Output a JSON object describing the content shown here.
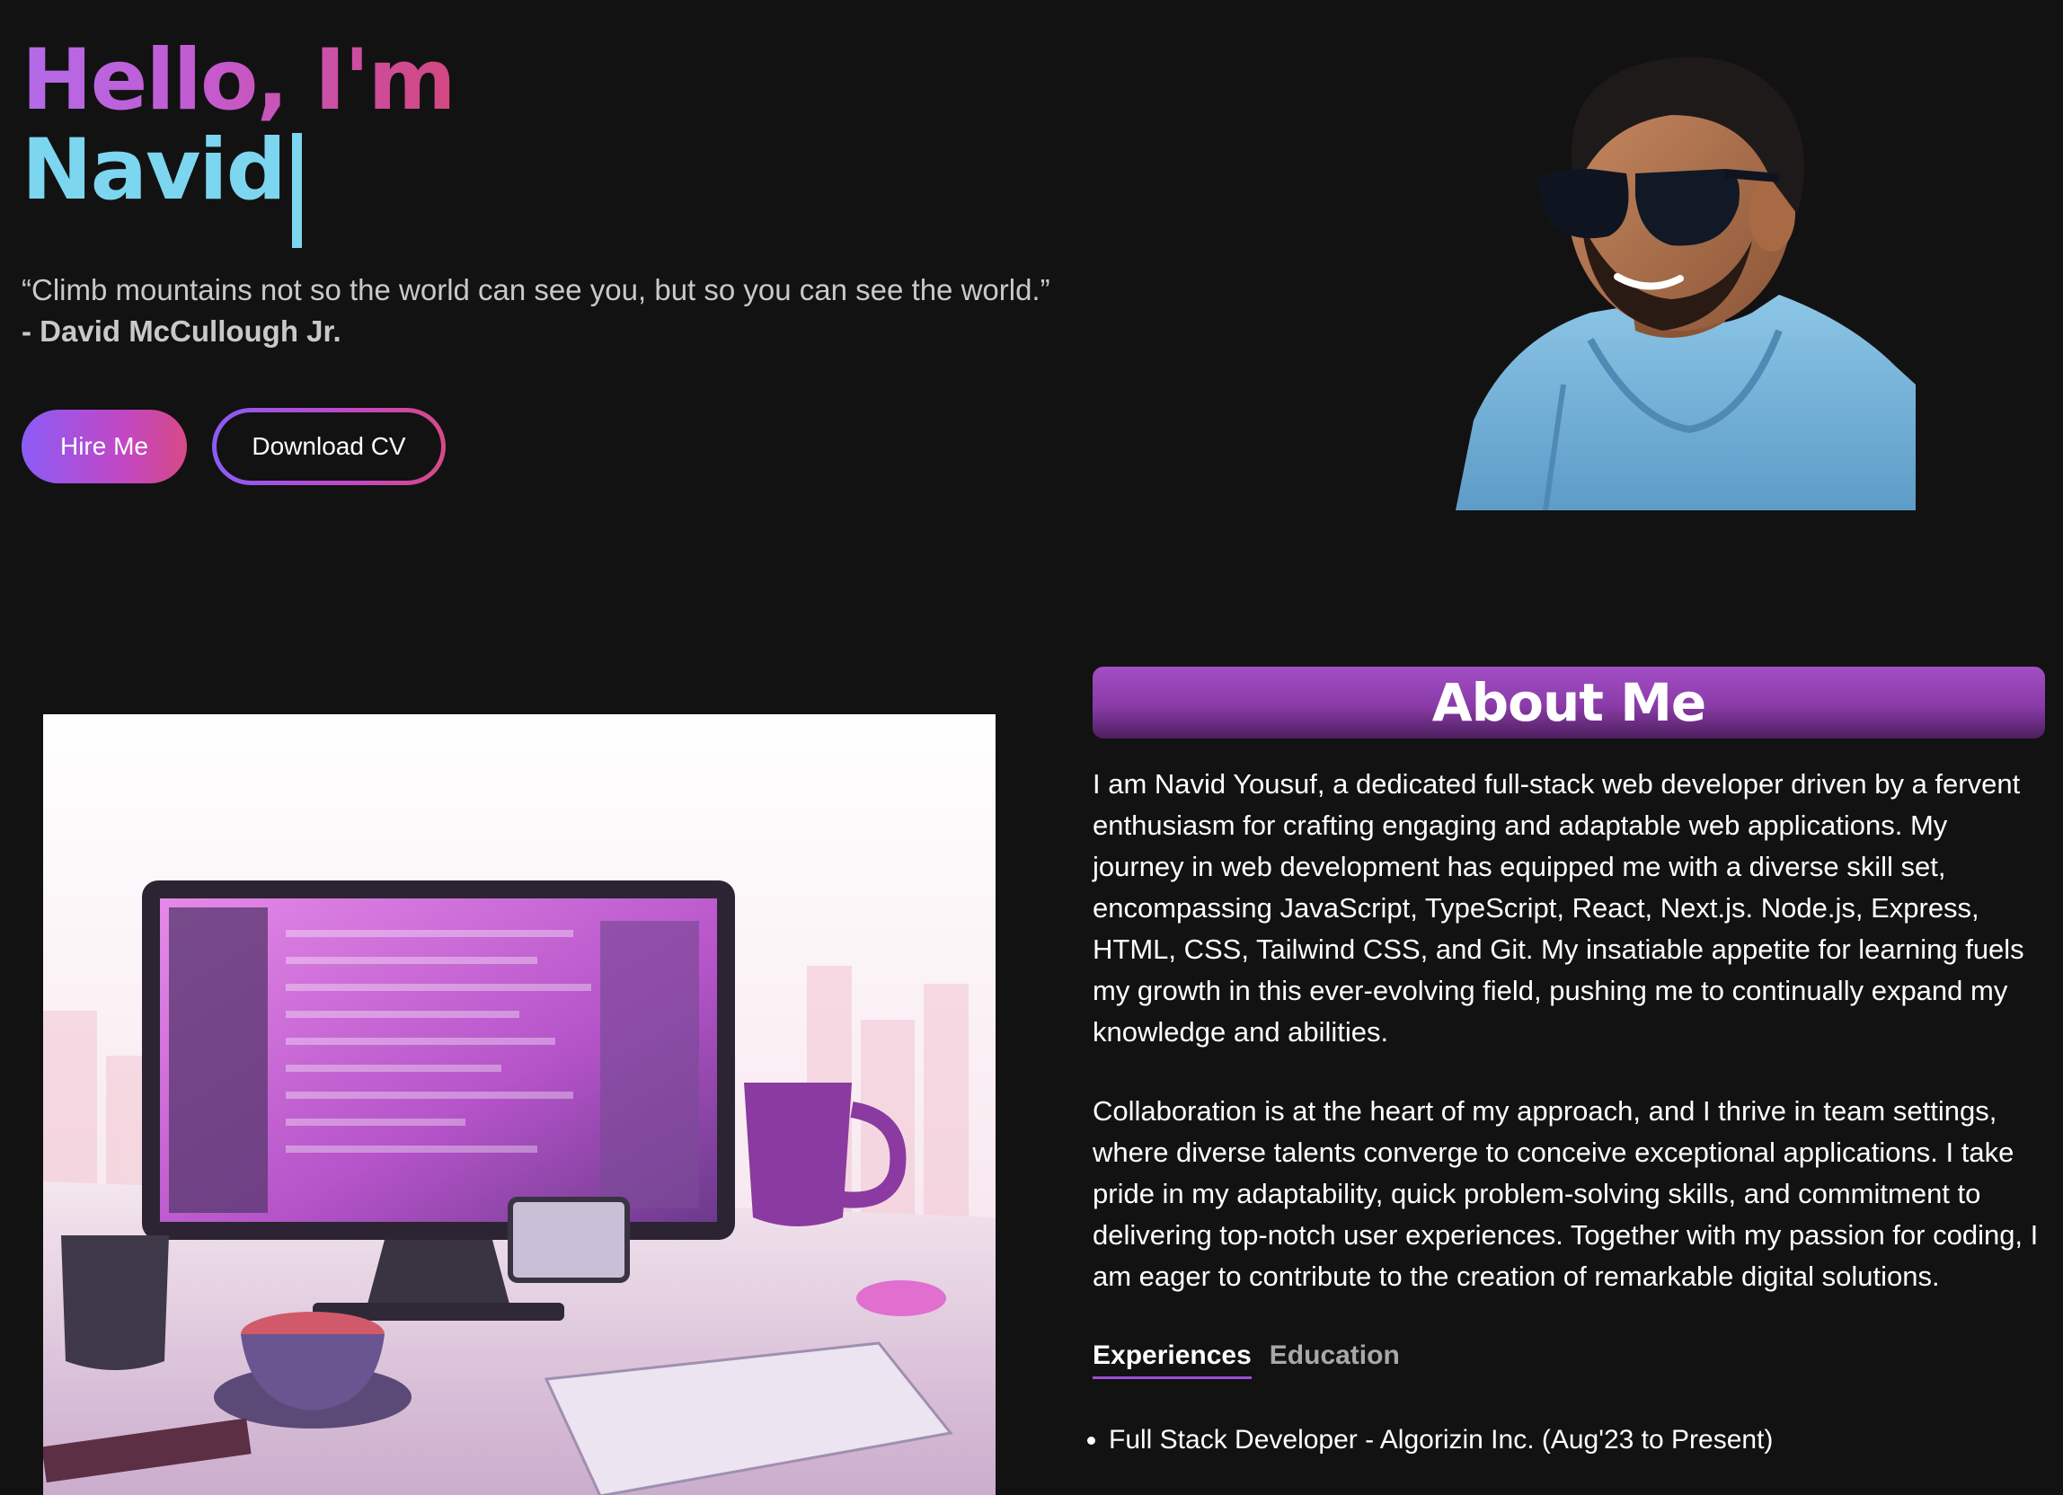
{
  "hero": {
    "greeting": "Hello, I'm",
    "name": "Navid",
    "quote": "“Climb mountains not so the world can see you, but so you can see the world.”",
    "quote_author": "- David McCullough Jr.",
    "hire_label": "Hire Me",
    "cv_label": "Download CV"
  },
  "about": {
    "title": "About Me",
    "paragraph1": "I am Navid Yousuf, a dedicated full-stack web developer driven by a fervent enthusiasm for crafting engaging and adaptable web applications. My journey in web development has equipped me with a diverse skill set, encompassing JavaScript, TypeScript, React, Next.js. Node.js, Express, HTML, CSS, Tailwind CSS, and Git. My insatiable appetite for learning fuels my growth in this ever-evolving field, pushing me to continually expand my knowledge and abilities.",
    "paragraph2": "Collaboration is at the heart of my approach, and I thrive in team settings, where diverse talents converge to conceive exceptional applications. I take pride in my adaptability, quick problem-solving skills, and commitment to delivering top-notch user experiences. Together with my passion for coding, I am eager to contribute to the creation of remarkable digital solutions.",
    "tabs": [
      {
        "label": "Experiences",
        "active": true
      },
      {
        "label": "Education",
        "active": false
      }
    ],
    "experiences": [
      "Full Stack Developer - Algorizin Inc. (Aug'23 to Present)"
    ]
  },
  "colors": {
    "background": "#121212",
    "accent_purple": "#8b5cf6",
    "accent_pink": "#d64a86",
    "name_cyan": "#7dd6ef"
  },
  "icons": {
    "avatar": "portrait-illustration",
    "workspace": "desk-computer-illustration"
  }
}
